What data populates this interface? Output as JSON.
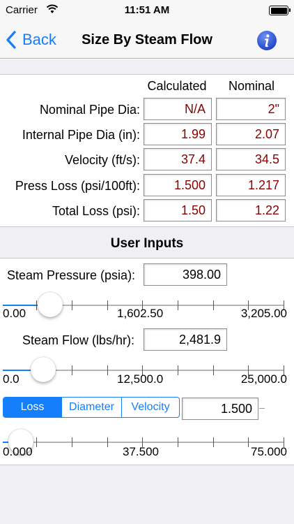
{
  "status_bar": {
    "carrier": "Carrier",
    "time": "11:51 AM"
  },
  "nav": {
    "back_label": "Back",
    "title": "Size By Steam Flow",
    "info_icon": "info-icon"
  },
  "results": {
    "col_calculated": "Calculated",
    "col_nominal": "Nominal",
    "rows": [
      {
        "label": "Nominal Pipe Dia:",
        "calculated": "N/A",
        "nominal": "2\""
      },
      {
        "label": "Internal Pipe Dia (in):",
        "calculated": "1.99",
        "nominal": "2.07"
      },
      {
        "label": "Velocity (ft/s):",
        "calculated": "37.4",
        "nominal": "34.5"
      },
      {
        "label": "Press Loss (psi/100ft):",
        "calculated": "1.500",
        "nominal": "1.217"
      },
      {
        "label": "Total Loss (psi):",
        "calculated": "1.50",
        "nominal": "1.22"
      }
    ]
  },
  "inputs": {
    "section_title": "User Inputs",
    "steam_pressure": {
      "label": "Steam Pressure (psia):",
      "value": "398.00",
      "slider_min": "0.00",
      "slider_mid": "1,602.50",
      "slider_max": "3,205.00",
      "slider_fraction": 0.124
    },
    "steam_flow": {
      "label": "Steam Flow (lbs/hr):",
      "value": "2,481.9",
      "slider_min": "0.0",
      "slider_mid": "12,500.0",
      "slider_max": "25,000.0",
      "slider_fraction": 0.099
    },
    "mode": {
      "segments": [
        "Loss",
        "Diameter",
        "Velocity"
      ],
      "selected": "Loss",
      "value": "1.500",
      "slider_min": "0.000",
      "slider_mid": "37.500",
      "slider_max": "75.000",
      "slider_fraction": 0.02
    }
  },
  "colors": {
    "accent": "#157efb",
    "result_text": "#8b0000",
    "gray_band": "#efeff4"
  }
}
